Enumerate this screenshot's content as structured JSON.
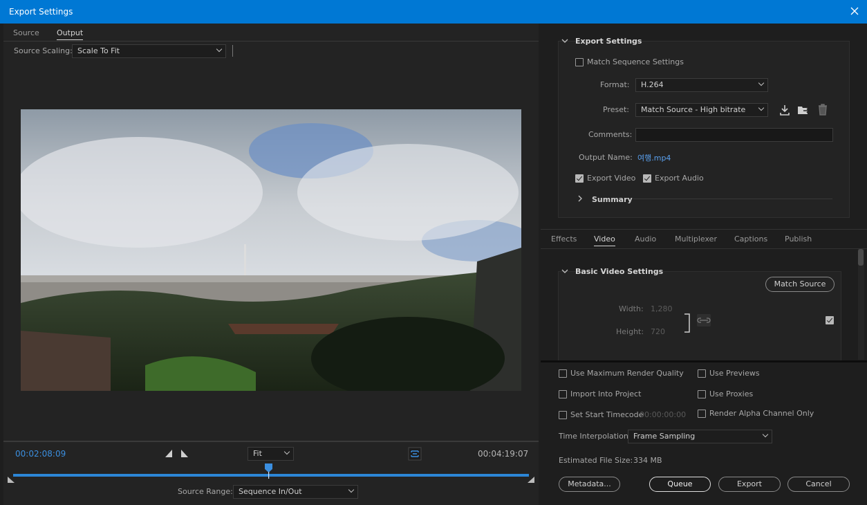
{
  "window": {
    "title": "Export Settings"
  },
  "left": {
    "tabs": [
      "Source",
      "Output"
    ],
    "active_tab": "Output",
    "source_scaling_label": "Source Scaling:",
    "source_scaling_value": "Scale To Fit",
    "current_time": "00:02:08:09",
    "fit_value": "Fit",
    "duration": "00:04:19:07",
    "source_range_label": "Source Range:",
    "source_range_value": "Sequence In/Out",
    "playhead_fraction": 0.494
  },
  "export_settings": {
    "section_title": "Export Settings",
    "match_sequence_label": "Match Sequence Settings",
    "format_label": "Format:",
    "format_value": "H.264",
    "preset_label": "Preset:",
    "preset_value": "Match Source - High bitrate",
    "comments_label": "Comments:",
    "comments_value": "",
    "output_name_label": "Output Name:",
    "output_name_value": "여행.mp4",
    "export_video_label": "Export Video",
    "export_audio_label": "Export Audio",
    "summary_label": "Summary"
  },
  "settings_tabs": [
    "Effects",
    "Video",
    "Audio",
    "Multiplexer",
    "Captions",
    "Publish"
  ],
  "active_settings_tab": "Video",
  "video": {
    "section_title": "Basic Video Settings",
    "match_source_button": "Match Source",
    "width_label": "Width:",
    "width_value": "1,280",
    "height_label": "Height:",
    "height_value": "720"
  },
  "options": {
    "max_render_quality": "Use Maximum Render Quality",
    "use_previews": "Use Previews",
    "import_into_project": "Import Into Project",
    "use_proxies": "Use Proxies",
    "set_start_timecode": "Set Start Timecode",
    "start_timecode_value": "00:00:00:00",
    "render_alpha": "Render Alpha Channel Only",
    "time_interpolation_label": "Time Interpolation:",
    "time_interpolation_value": "Frame Sampling",
    "file_size_label": "Estimated File Size:",
    "file_size_value": "334 MB"
  },
  "buttons": {
    "metadata": "Metadata...",
    "queue": "Queue",
    "export": "Export",
    "cancel": "Cancel"
  },
  "colors": {
    "accent": "#0078d4",
    "timecode": "#3b8fe0",
    "link": "#5aa0ee"
  }
}
